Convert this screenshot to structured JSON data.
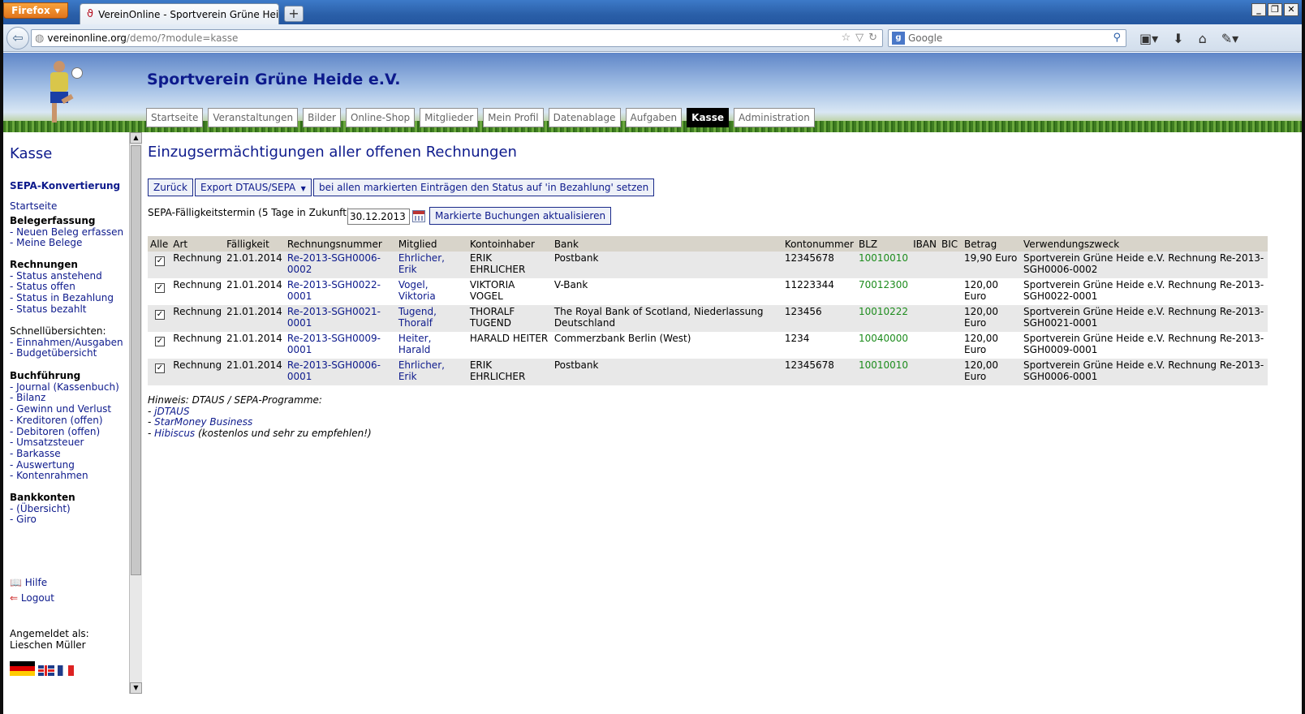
{
  "browser": {
    "menu_button": "Firefox",
    "tab_title": "VereinOnline - Sportverein Grüne Heide e.V.",
    "new_tab": "+",
    "url_domain": "vereinonline.org",
    "url_path": "/demo/?module=kasse",
    "search_placeholder": "Google"
  },
  "site": {
    "title": "Sportverein Grüne Heide e.V.",
    "nav": [
      "Startseite",
      "Veranstaltungen",
      "Bilder",
      "Online-Shop",
      "Mitglieder",
      "Mein Profil",
      "Datenablage",
      "Aufgaben",
      "Kasse",
      "Administration"
    ],
    "active_nav": "Kasse"
  },
  "sidebar": {
    "title": "Kasse",
    "sepa_link": "SEPA-Konvertierung",
    "start_link": "Startseite",
    "groups": [
      {
        "head": "Belegerfassung",
        "items": [
          "- Neuen Beleg erfassen",
          "- Meine Belege"
        ]
      },
      {
        "head": "Rechnungen",
        "items": [
          "- Status anstehend",
          "- Status offen",
          "- Status in Bezahlung",
          "- Status bezahlt"
        ]
      },
      {
        "head": "Schnellübersichten:",
        "items": [
          "- Einnahmen/Ausgaben",
          "- Budgetübersicht"
        ]
      },
      {
        "head": "Buchführung",
        "items": [
          "- Journal (Kassenbuch)",
          "- Bilanz",
          "- Gewinn und Verlust",
          "- Kreditoren (offen)",
          "- Debitoren (offen)",
          "- Umsatzsteuer",
          "- Barkasse",
          "- Auswertung",
          "- Kontenrahmen"
        ]
      },
      {
        "head": "Bankkonten",
        "items": [
          "- (Übersicht)",
          "- Giro"
        ]
      }
    ],
    "help": "Hilfe",
    "logout": "Logout",
    "logged_in_label": "Angemeldet als:",
    "logged_in_user": "Lieschen Müller"
  },
  "main": {
    "heading": "Einzugsermächtigungen aller offenen Rechnungen",
    "back_button": "Zurück",
    "export_button": "Export DTAUS/SEPA",
    "status_button": "bei allen markierten Einträgen den Status auf 'in Bezahlung' setzen",
    "sepa_label": "SEPA-Fälligkeitstermin (5 Tage in Zukunft):",
    "sepa_date": "30.12.2013",
    "update_button": "Markierte Buchungen aktualisieren",
    "columns": [
      "Alle",
      "Art",
      "Fälligkeit",
      "Rechnungsnummer",
      "Mitglied",
      "Kontoinhaber",
      "Bank",
      "Kontonummer",
      "BLZ",
      "IBAN",
      "BIC",
      "Betrag",
      "Verwendungszweck"
    ],
    "rows": [
      {
        "checked": true,
        "art": "Rechnung",
        "due": "21.01.2014",
        "nr": "Re-2013-SGH0006-0002",
        "member": "Ehrlicher, Erik",
        "holder": "ERIK EHRLICHER",
        "bank": "Postbank",
        "account": "12345678",
        "blz": "10010010",
        "iban": "",
        "bic": "",
        "amount": "19,90 Euro",
        "purpose": "Sportverein Grüne Heide e.V. Rechnung Re-2013-SGH0006-0002"
      },
      {
        "checked": true,
        "art": "Rechnung",
        "due": "21.01.2014",
        "nr": "Re-2013-SGH0022-0001",
        "member": "Vogel, Viktoria",
        "holder": "VIKTORIA VOGEL",
        "bank": "V-Bank",
        "account": "11223344",
        "blz": "70012300",
        "iban": "",
        "bic": "",
        "amount": "120,00 Euro",
        "purpose": "Sportverein Grüne Heide e.V. Rechnung Re-2013-SGH0022-0001"
      },
      {
        "checked": true,
        "art": "Rechnung",
        "due": "21.01.2014",
        "nr": "Re-2013-SGH0021-0001",
        "member": "Tugend, Thoralf",
        "holder": "THORALF TUGEND",
        "bank": "The Royal Bank of Scotland, Niederlassung Deutschland",
        "account": "123456",
        "blz": "10010222",
        "iban": "",
        "bic": "",
        "amount": "120,00 Euro",
        "purpose": "Sportverein Grüne Heide e.V. Rechnung Re-2013-SGH0021-0001"
      },
      {
        "checked": true,
        "art": "Rechnung",
        "due": "21.01.2014",
        "nr": "Re-2013-SGH0009-0001",
        "member": "Heiter, Harald",
        "holder": "HARALD HEITER",
        "bank": "Commerzbank Berlin (West)",
        "account": "1234",
        "blz": "10040000",
        "iban": "",
        "bic": "",
        "amount": "120,00 Euro",
        "purpose": "Sportverein Grüne Heide e.V. Rechnung Re-2013-SGH0009-0001"
      },
      {
        "checked": true,
        "art": "Rechnung",
        "due": "21.01.2014",
        "nr": "Re-2013-SGH0006-0001",
        "member": "Ehrlicher, Erik",
        "holder": "ERIK EHRLICHER",
        "bank": "Postbank",
        "account": "12345678",
        "blz": "10010010",
        "iban": "",
        "bic": "",
        "amount": "120,00 Euro",
        "purpose": "Sportverein Grüne Heide e.V. Rechnung Re-2013-SGH0006-0001"
      }
    ],
    "hint_title": "Hinweis: DTAUS / SEPA-Programme:",
    "hint_links": [
      {
        "label": "jDTAUS",
        "suffix": ""
      },
      {
        "label": "StarMoney Business",
        "suffix": ""
      },
      {
        "label": "Hibiscus",
        "suffix": " (kostenlos und sehr zu empfehlen!)"
      }
    ]
  }
}
